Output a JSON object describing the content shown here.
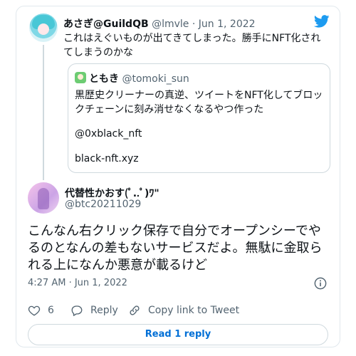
{
  "tweet": {
    "author_name": "あさぎ@GuildQB",
    "author_handle": "@lmvle",
    "separator": "·",
    "date": "Jun 1, 2022",
    "text": "これはえぐいものが出てきてしまった。勝手にNFT化されてしまうのかな"
  },
  "quote": {
    "author_name": "ともき",
    "author_handle": "@tomoki_sun",
    "text": "黒歴史クリーナーの真逆、ツイートをNFT化してブロックチェーンに刻み消せなくなるやつ作った",
    "mention": "@0xblack_nft",
    "link": "black-nft.xyz"
  },
  "reply": {
    "author_name": "代替性かおす(ﾟ..ﾟ)ﾜ\"",
    "author_handle": "@btc20211029",
    "text": "こんなん右クリック保存で自分でオープンシーでやるのとなんの差もないサービスだよ。無駄に金取られる上になんか悪意が載るけど",
    "timestamp": "4:27 AM · Jun 1, 2022"
  },
  "actions": {
    "like_count": "6",
    "reply_label": "Reply",
    "copy_label": "Copy link to Tweet",
    "read_replies_label": "Read 1 reply"
  },
  "icons": {
    "brand": "twitter-bird-icon",
    "info": "info-icon",
    "like": "heart-icon",
    "reply": "reply-bubble-icon",
    "copy": "link-icon"
  },
  "colors": {
    "twitter_blue": "#1d9bf0",
    "link_blue": "#006fd6",
    "muted": "#536471",
    "border": "#cfd9de"
  }
}
